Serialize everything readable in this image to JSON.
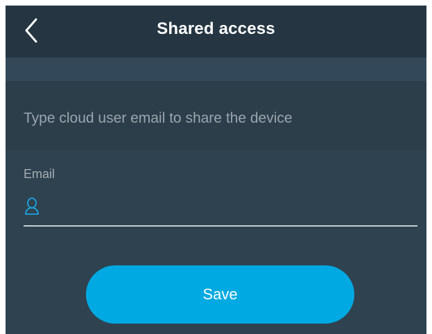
{
  "header": {
    "title": "Shared access",
    "back_icon": "chevron-left-icon"
  },
  "prompt": {
    "text": "Type cloud user email to share the device"
  },
  "form": {
    "email_label": "Email",
    "email_icon": "user-icon",
    "email_value": "",
    "email_placeholder": ""
  },
  "actions": {
    "save_label": "Save"
  },
  "colors": {
    "header_bg": "#253642",
    "band_bg": "#33495a",
    "prompt_bg": "#2c3e4a",
    "form_bg": "#2f4250",
    "accent": "#00a9e2",
    "icon_accent": "#1aa7e0"
  }
}
